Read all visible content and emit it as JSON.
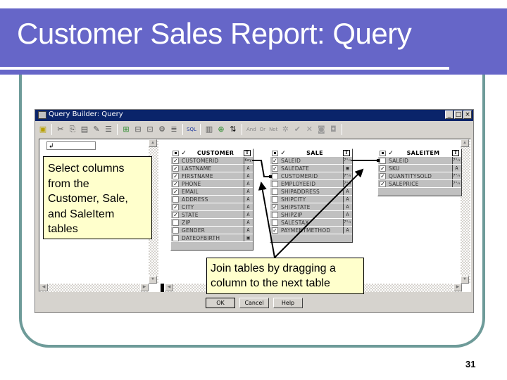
{
  "slide": {
    "title": "Customer Sales Report: Query",
    "page_number": "31",
    "colors": {
      "header": "#6666c8",
      "frame": "#6e9b99",
      "callout_bg": "#ffffcc",
      "window_titlebar": "#0a246a"
    }
  },
  "window": {
    "title": "Query Builder: Query",
    "controls": {
      "minimize": "_",
      "maximize": "□",
      "close": "×"
    },
    "toolbar": {
      "icons": [
        "save-icon",
        "cut-icon",
        "copy-icon",
        "paste-icon",
        "format-painter-icon",
        "properties-icon",
        "add-table-icon",
        "remove-table-icon",
        "add-criteria-icon",
        "group-icon",
        "sort-icon",
        "sql-view-icon",
        "add-column-icon",
        "add-expression-icon",
        "sort-order-icon",
        "and-icon",
        "or-icon",
        "not-icon",
        "wildcard-icon",
        "check-icon",
        "delete-icon",
        "run-icon",
        "clear-icon"
      ],
      "and_label": "And",
      "or_label": "Or",
      "not_label": "Not",
      "sql_label": "SQL"
    },
    "criteria_input_value": "↲",
    "buttons": {
      "ok": "OK",
      "cancel": "Cancel",
      "help": "Help"
    }
  },
  "tables": [
    {
      "name": "CUSTOMER",
      "columns": [
        {
          "name": "CUSTOMERID",
          "checked": true,
          "type": "key"
        },
        {
          "name": "LASTNAME",
          "checked": true,
          "type": "text"
        },
        {
          "name": "FIRSTNAME",
          "checked": true,
          "type": "text"
        },
        {
          "name": "PHONE",
          "checked": true,
          "type": "text"
        },
        {
          "name": "EMAIL",
          "checked": true,
          "type": "text"
        },
        {
          "name": "ADDRESS",
          "checked": false,
          "type": "text"
        },
        {
          "name": "CITY",
          "checked": true,
          "type": "text"
        },
        {
          "name": "STATE",
          "checked": true,
          "type": "text"
        },
        {
          "name": "ZIP",
          "checked": false,
          "type": "text"
        },
        {
          "name": "GENDER",
          "checked": false,
          "type": "text"
        },
        {
          "name": "DATEOFBIRTH",
          "checked": false,
          "type": "date"
        }
      ]
    },
    {
      "name": "SALE",
      "columns": [
        {
          "name": "SALEID",
          "checked": true,
          "type": "number"
        },
        {
          "name": "SALEDATE",
          "checked": true,
          "type": "date"
        },
        {
          "name": "CUSTOMERID",
          "checked": false,
          "type": "number"
        },
        {
          "name": "EMPLOYEEID",
          "checked": false,
          "type": "number"
        },
        {
          "name": "SHIPADDRESS",
          "checked": false,
          "type": "text"
        },
        {
          "name": "SHIPCITY",
          "checked": false,
          "type": "text"
        },
        {
          "name": "SHIPSTATE",
          "checked": true,
          "type": "text"
        },
        {
          "name": "SHIPZIP",
          "checked": false,
          "type": "text"
        },
        {
          "name": "SALESTAX",
          "checked": false,
          "type": "number"
        },
        {
          "name": "PAYMENTMETHOD",
          "checked": true,
          "type": "text"
        }
      ]
    },
    {
      "name": "SALEITEM",
      "columns": [
        {
          "name": "SALEID",
          "checked": false,
          "type": "number"
        },
        {
          "name": "SKU",
          "checked": true,
          "type": "text"
        },
        {
          "name": "QUANTITYSOLD",
          "checked": true,
          "type": "number"
        },
        {
          "name": "SALEPRICE",
          "checked": true,
          "type": "number"
        }
      ]
    }
  ],
  "type_glyphs": {
    "key": "Key",
    "text": "A",
    "date": "▣",
    "number": "7⁰⁄₉"
  },
  "header_glyphs": {
    "check": "✓",
    "type": "T"
  },
  "callouts": {
    "select_columns": [
      "Select columns",
      "from the",
      "Customer, Sale,",
      "and SaleItem",
      "tables"
    ],
    "join_tables": [
      "Join tables by dragging a",
      "column to the next table"
    ]
  }
}
